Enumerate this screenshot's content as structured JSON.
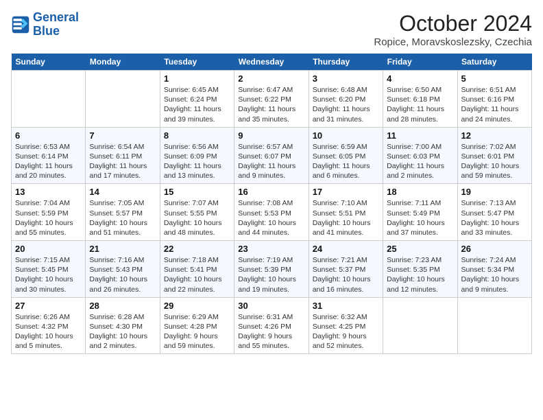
{
  "header": {
    "logo_line1": "General",
    "logo_line2": "Blue",
    "month": "October 2024",
    "location": "Ropice, Moravskoslezsky, Czechia"
  },
  "weekdays": [
    "Sunday",
    "Monday",
    "Tuesday",
    "Wednesday",
    "Thursday",
    "Friday",
    "Saturday"
  ],
  "weeks": [
    [
      {
        "day": "",
        "sunrise": "",
        "sunset": "",
        "daylight": ""
      },
      {
        "day": "",
        "sunrise": "",
        "sunset": "",
        "daylight": ""
      },
      {
        "day": "1",
        "sunrise": "Sunrise: 6:45 AM",
        "sunset": "Sunset: 6:24 PM",
        "daylight": "Daylight: 11 hours and 39 minutes."
      },
      {
        "day": "2",
        "sunrise": "Sunrise: 6:47 AM",
        "sunset": "Sunset: 6:22 PM",
        "daylight": "Daylight: 11 hours and 35 minutes."
      },
      {
        "day": "3",
        "sunrise": "Sunrise: 6:48 AM",
        "sunset": "Sunset: 6:20 PM",
        "daylight": "Daylight: 11 hours and 31 minutes."
      },
      {
        "day": "4",
        "sunrise": "Sunrise: 6:50 AM",
        "sunset": "Sunset: 6:18 PM",
        "daylight": "Daylight: 11 hours and 28 minutes."
      },
      {
        "day": "5",
        "sunrise": "Sunrise: 6:51 AM",
        "sunset": "Sunset: 6:16 PM",
        "daylight": "Daylight: 11 hours and 24 minutes."
      }
    ],
    [
      {
        "day": "6",
        "sunrise": "Sunrise: 6:53 AM",
        "sunset": "Sunset: 6:14 PM",
        "daylight": "Daylight: 11 hours and 20 minutes."
      },
      {
        "day": "7",
        "sunrise": "Sunrise: 6:54 AM",
        "sunset": "Sunset: 6:11 PM",
        "daylight": "Daylight: 11 hours and 17 minutes."
      },
      {
        "day": "8",
        "sunrise": "Sunrise: 6:56 AM",
        "sunset": "Sunset: 6:09 PM",
        "daylight": "Daylight: 11 hours and 13 minutes."
      },
      {
        "day": "9",
        "sunrise": "Sunrise: 6:57 AM",
        "sunset": "Sunset: 6:07 PM",
        "daylight": "Daylight: 11 hours and 9 minutes."
      },
      {
        "day": "10",
        "sunrise": "Sunrise: 6:59 AM",
        "sunset": "Sunset: 6:05 PM",
        "daylight": "Daylight: 11 hours and 6 minutes."
      },
      {
        "day": "11",
        "sunrise": "Sunrise: 7:00 AM",
        "sunset": "Sunset: 6:03 PM",
        "daylight": "Daylight: 11 hours and 2 minutes."
      },
      {
        "day": "12",
        "sunrise": "Sunrise: 7:02 AM",
        "sunset": "Sunset: 6:01 PM",
        "daylight": "Daylight: 10 hours and 59 minutes."
      }
    ],
    [
      {
        "day": "13",
        "sunrise": "Sunrise: 7:04 AM",
        "sunset": "Sunset: 5:59 PM",
        "daylight": "Daylight: 10 hours and 55 minutes."
      },
      {
        "day": "14",
        "sunrise": "Sunrise: 7:05 AM",
        "sunset": "Sunset: 5:57 PM",
        "daylight": "Daylight: 10 hours and 51 minutes."
      },
      {
        "day": "15",
        "sunrise": "Sunrise: 7:07 AM",
        "sunset": "Sunset: 5:55 PM",
        "daylight": "Daylight: 10 hours and 48 minutes."
      },
      {
        "day": "16",
        "sunrise": "Sunrise: 7:08 AM",
        "sunset": "Sunset: 5:53 PM",
        "daylight": "Daylight: 10 hours and 44 minutes."
      },
      {
        "day": "17",
        "sunrise": "Sunrise: 7:10 AM",
        "sunset": "Sunset: 5:51 PM",
        "daylight": "Daylight: 10 hours and 41 minutes."
      },
      {
        "day": "18",
        "sunrise": "Sunrise: 7:11 AM",
        "sunset": "Sunset: 5:49 PM",
        "daylight": "Daylight: 10 hours and 37 minutes."
      },
      {
        "day": "19",
        "sunrise": "Sunrise: 7:13 AM",
        "sunset": "Sunset: 5:47 PM",
        "daylight": "Daylight: 10 hours and 33 minutes."
      }
    ],
    [
      {
        "day": "20",
        "sunrise": "Sunrise: 7:15 AM",
        "sunset": "Sunset: 5:45 PM",
        "daylight": "Daylight: 10 hours and 30 minutes."
      },
      {
        "day": "21",
        "sunrise": "Sunrise: 7:16 AM",
        "sunset": "Sunset: 5:43 PM",
        "daylight": "Daylight: 10 hours and 26 minutes."
      },
      {
        "day": "22",
        "sunrise": "Sunrise: 7:18 AM",
        "sunset": "Sunset: 5:41 PM",
        "daylight": "Daylight: 10 hours and 22 minutes."
      },
      {
        "day": "23",
        "sunrise": "Sunrise: 7:19 AM",
        "sunset": "Sunset: 5:39 PM",
        "daylight": "Daylight: 10 hours and 19 minutes."
      },
      {
        "day": "24",
        "sunrise": "Sunrise: 7:21 AM",
        "sunset": "Sunset: 5:37 PM",
        "daylight": "Daylight: 10 hours and 16 minutes."
      },
      {
        "day": "25",
        "sunrise": "Sunrise: 7:23 AM",
        "sunset": "Sunset: 5:35 PM",
        "daylight": "Daylight: 10 hours and 12 minutes."
      },
      {
        "day": "26",
        "sunrise": "Sunrise: 7:24 AM",
        "sunset": "Sunset: 5:34 PM",
        "daylight": "Daylight: 10 hours and 9 minutes."
      }
    ],
    [
      {
        "day": "27",
        "sunrise": "Sunrise: 6:26 AM",
        "sunset": "Sunset: 4:32 PM",
        "daylight": "Daylight: 10 hours and 5 minutes."
      },
      {
        "day": "28",
        "sunrise": "Sunrise: 6:28 AM",
        "sunset": "Sunset: 4:30 PM",
        "daylight": "Daylight: 10 hours and 2 minutes."
      },
      {
        "day": "29",
        "sunrise": "Sunrise: 6:29 AM",
        "sunset": "Sunset: 4:28 PM",
        "daylight": "Daylight: 9 hours and 59 minutes."
      },
      {
        "day": "30",
        "sunrise": "Sunrise: 6:31 AM",
        "sunset": "Sunset: 4:26 PM",
        "daylight": "Daylight: 9 hours and 55 minutes."
      },
      {
        "day": "31",
        "sunrise": "Sunrise: 6:32 AM",
        "sunset": "Sunset: 4:25 PM",
        "daylight": "Daylight: 9 hours and 52 minutes."
      },
      {
        "day": "",
        "sunrise": "",
        "sunset": "",
        "daylight": ""
      },
      {
        "day": "",
        "sunrise": "",
        "sunset": "",
        "daylight": ""
      }
    ]
  ]
}
